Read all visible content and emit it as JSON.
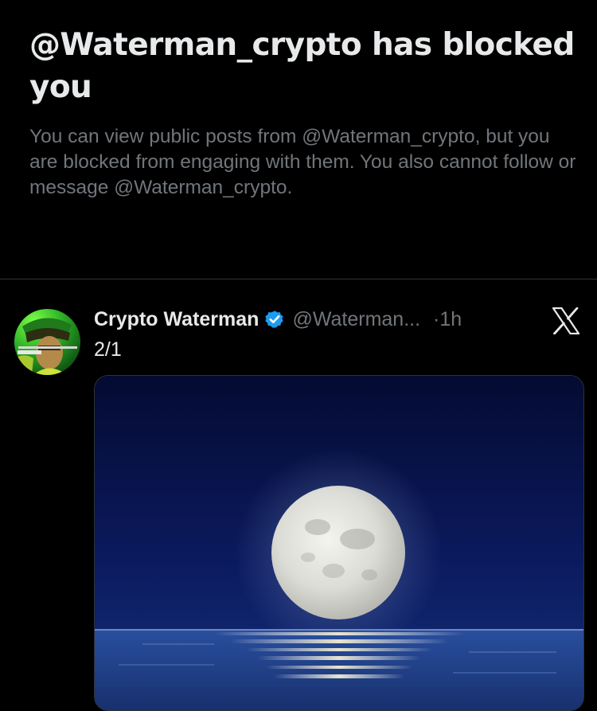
{
  "blocked_notice": {
    "title": "@Waterman_crypto has blocked you",
    "description": "You can view public posts from @Waterman_crypto, but you are blocked from engaging with them. You also cannot follow or message @Waterman_crypto."
  },
  "post": {
    "author_name": "Crypto Waterman",
    "author_handle": "@Waterman...",
    "separator": "·",
    "time": "1h",
    "text": "2/1",
    "verified": true,
    "media_description": "full moon over the sea at night"
  },
  "icons": {
    "verified": "verified-badge-icon",
    "platform": "x-logo-icon"
  },
  "colors": {
    "background": "#000000",
    "primary_text": "#e7e9ea",
    "secondary_text": "#71767b",
    "verified_blue": "#1d9bf0",
    "divider": "#2f3336"
  }
}
